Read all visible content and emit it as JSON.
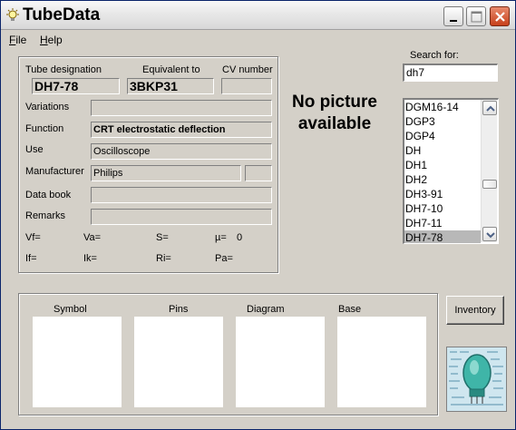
{
  "window": {
    "title": "TubeData"
  },
  "menu": [
    {
      "accel": "F",
      "rest": "ile"
    },
    {
      "accel": "H",
      "rest": "elp"
    }
  ],
  "fields": {
    "tube_designation_label": "Tube designation",
    "equivalent_label": "Equivalent to",
    "cv_label": "CV number",
    "tube_designation": "DH7-78",
    "equivalent": "3BKP31",
    "cv_number": "",
    "variations_label": "Variations",
    "variations": "",
    "function_label": "Function",
    "function": "CRT electrostatic deflection",
    "use_label": "Use",
    "use": "Oscilloscope",
    "manufacturer_label": "Manufacturer",
    "manufacturer": "Philips",
    "manufacturer_code": "",
    "data_book_label": "Data book",
    "data_book": "",
    "remarks_label": "Remarks",
    "remarks": ""
  },
  "params": {
    "vf": "Vf=",
    "va": "Va=",
    "s": "S=",
    "mu": "µ=",
    "mu_value": "0",
    "if": "If=",
    "ik": "Ik=",
    "ri": "Ri=",
    "pa": "Pa="
  },
  "picture": {
    "text": "No picture available"
  },
  "search": {
    "label": "Search for:",
    "value": "dh7"
  },
  "list": {
    "items": [
      "DGM16-14",
      "DGP3",
      "DGP4",
      "DH",
      "DH1",
      "DH2",
      "DH3-91",
      "DH7-10",
      "DH7-11",
      "DH7-78"
    ],
    "selected": "DH7-78"
  },
  "bottom": {
    "symbol_label": "Symbol",
    "pins_label": "Pins",
    "diagram_label": "Diagram",
    "base_label": "Base"
  },
  "inventory_button": "Inventory",
  "colors": {
    "selection": "#b8b8b8",
    "face": "#d4d0c8",
    "close_button": "#c7401b"
  },
  "icons": [
    "bulb-icon",
    "minimize-icon",
    "maximize-icon",
    "close-icon",
    "scroll-up-icon",
    "scroll-down-icon",
    "tube-logo"
  ]
}
